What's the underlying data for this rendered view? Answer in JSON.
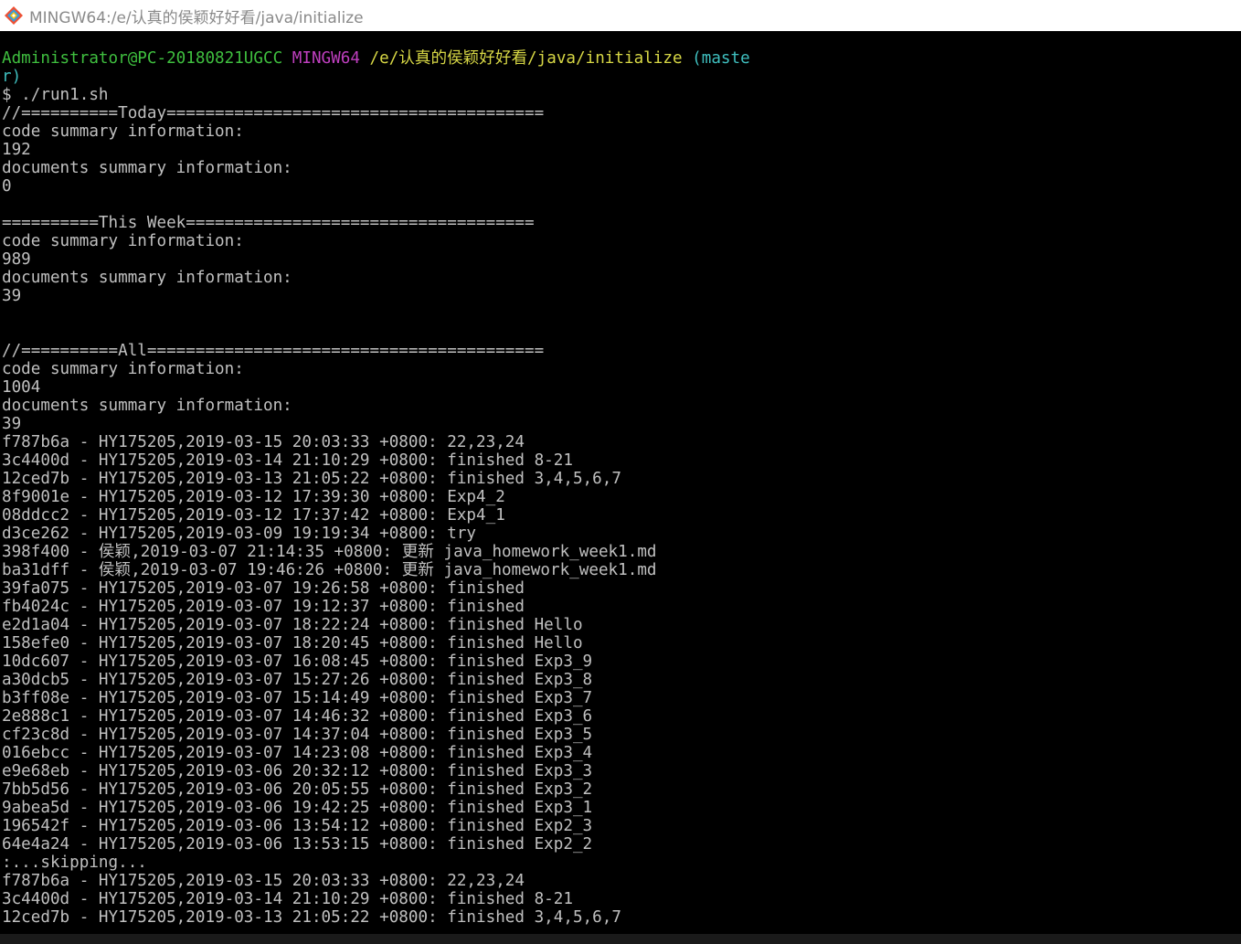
{
  "window": {
    "title": "MINGW64:/e/认真的侯颖好好看/java/initialize",
    "icon": "git-bash-icon"
  },
  "colors": {
    "background": "#000000",
    "text": "#c0c0c0",
    "user_host": "#3fbf3f",
    "shell_name": "#bf3fbf",
    "path": "#d7d745",
    "branch": "#3fbfbf"
  },
  "prompt": {
    "user_host": "Administrator@PC-20180821UGCC",
    "shell": "MINGW64",
    "path": "/e/认真的侯颖好好看/java/initialize",
    "branch_part1": "(maste",
    "branch_part2": "r)",
    "command": "$ ./run1.sh"
  },
  "output": [
    "//==========Today=======================================",
    "code summary information:",
    "192",
    "documents summary information:",
    "0",
    "",
    "==========This Week====================================",
    "code summary information:",
    "989",
    "documents summary information:",
    "39",
    "",
    "",
    "//==========All=========================================",
    "code summary information:",
    "1004",
    "documents summary information:",
    "39",
    "f787b6a - HY175205,2019-03-15 20:03:33 +0800: 22,23,24",
    "3c4400d - HY175205,2019-03-14 21:10:29 +0800: finished 8-21",
    "12ced7b - HY175205,2019-03-13 21:05:22 +0800: finished 3,4,5,6,7",
    "8f9001e - HY175205,2019-03-12 17:39:30 +0800: Exp4_2",
    "08ddcc2 - HY175205,2019-03-12 17:37:42 +0800: Exp4_1",
    "d3ce262 - HY175205,2019-03-09 19:19:34 +0800: try",
    "398f400 - 侯颖,2019-03-07 21:14:35 +0800: 更新 java_homework_week1.md",
    "ba31dff - 侯颖,2019-03-07 19:46:26 +0800: 更新 java_homework_week1.md",
    "39fa075 - HY175205,2019-03-07 19:26:58 +0800: finished",
    "fb4024c - HY175205,2019-03-07 19:12:37 +0800: finished",
    "e2d1a04 - HY175205,2019-03-07 18:22:24 +0800: finished Hello",
    "158efe0 - HY175205,2019-03-07 18:20:45 +0800: finished Hello",
    "10dc607 - HY175205,2019-03-07 16:08:45 +0800: finished Exp3_9",
    "a30dcb5 - HY175205,2019-03-07 15:27:26 +0800: finished Exp3_8",
    "b3ff08e - HY175205,2019-03-07 15:14:49 +0800: finished Exp3_7",
    "2e888c1 - HY175205,2019-03-07 14:46:32 +0800: finished Exp3_6",
    "cf23c8d - HY175205,2019-03-07 14:37:04 +0800: finished Exp3_5",
    "016ebcc - HY175205,2019-03-07 14:23:08 +0800: finished Exp3_4",
    "e9e68eb - HY175205,2019-03-06 20:32:12 +0800: finished Exp3_3",
    "7bb5d56 - HY175205,2019-03-06 20:05:55 +0800: finished Exp3_2",
    "9abea5d - HY175205,2019-03-06 19:42:25 +0800: finished Exp3_1",
    "196542f - HY175205,2019-03-06 13:54:12 +0800: finished Exp2_3",
    "64e4a24 - HY175205,2019-03-06 13:53:15 +0800: finished Exp2_2",
    ":...skipping...",
    "f787b6a - HY175205,2019-03-15 20:03:33 +0800: 22,23,24",
    "3c4400d - HY175205,2019-03-14 21:10:29 +0800: finished 8-21",
    "12ced7b - HY175205,2019-03-13 21:05:22 +0800: finished 3,4,5,6,7"
  ]
}
